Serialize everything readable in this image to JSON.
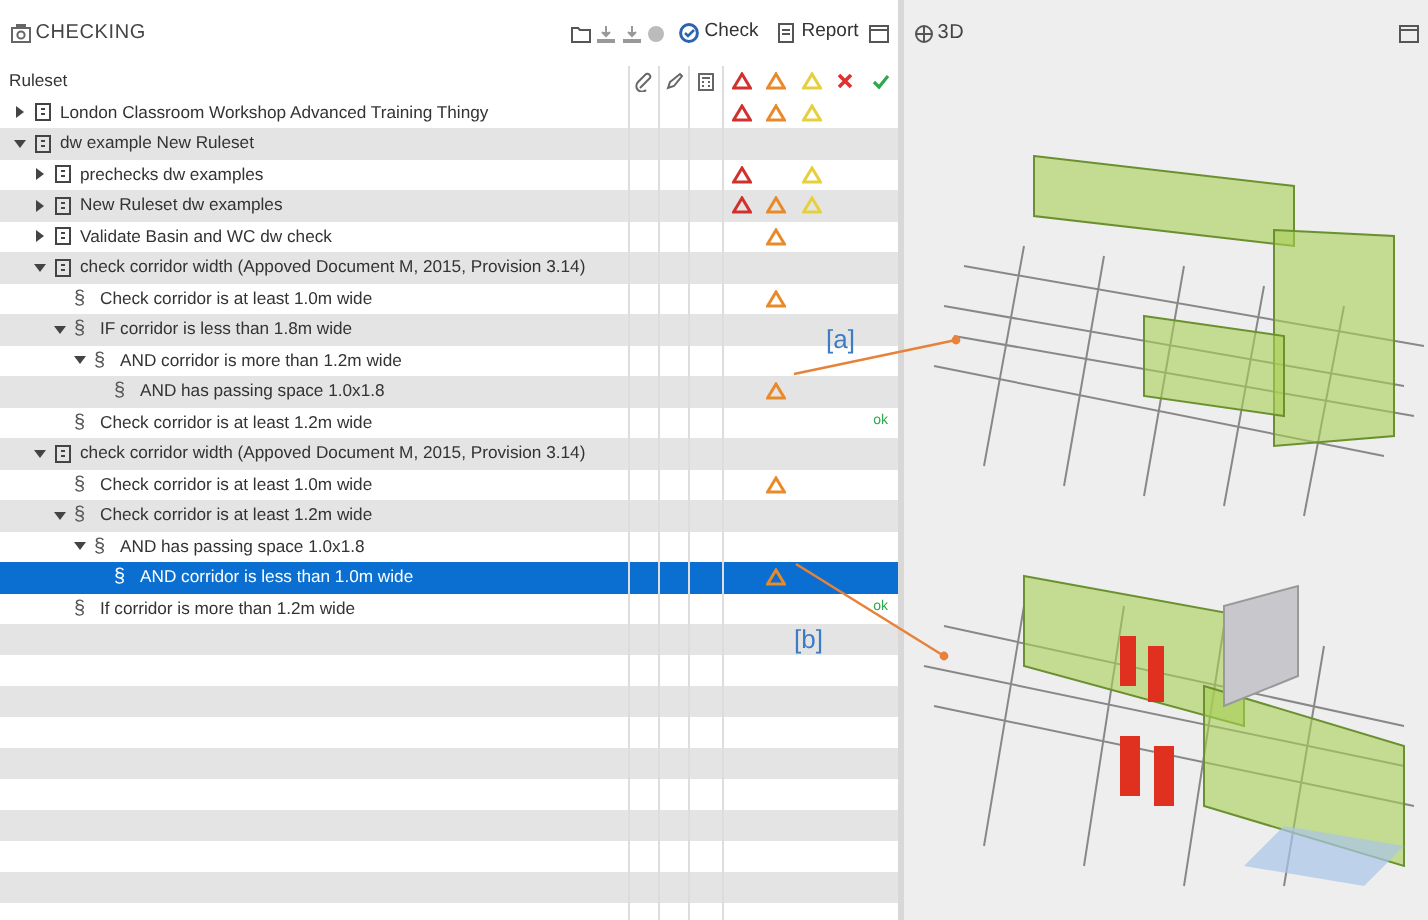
{
  "checking_panel": {
    "title": "CHECKING",
    "toolbar": [
      {
        "label": "Check"
      },
      {
        "label": "Report"
      }
    ],
    "header": {
      "column": "Ruleset"
    },
    "rows": [
      {
        "label": "London Classroom Workshop Advanced Training Thingy",
        "kind": "ruleset",
        "expanded": false,
        "selected": false,
        "critical": true,
        "major": true,
        "minor": true
      },
      {
        "label": "dw example New Ruleset",
        "kind": "ruleset",
        "expanded": true,
        "selected": false,
        "critical": false,
        "major": false,
        "minor": false,
        "children": [
          {
            "label": "prechecks dw examples",
            "kind": "ruleset",
            "expanded": false,
            "selected": false,
            "critical": true,
            "major": false,
            "minor": true
          },
          {
            "label": "New Ruleset dw examples",
            "kind": "ruleset",
            "expanded": false,
            "selected": false,
            "critical": true,
            "major": true,
            "minor": true
          },
          {
            "label": "Validate Basin and WC dw check",
            "kind": "ruleset",
            "expanded": false,
            "selected": false,
            "critical": false,
            "major": true,
            "minor": false
          },
          {
            "label": "check corridor width (Appoved Document M, 2015, Provision 3.14)",
            "kind": "ruleset",
            "expanded": true,
            "selected": false,
            "critical": false,
            "major": false,
            "minor": false,
            "children": [
              {
                "label": "Check corridor is at least 1.0m wide",
                "kind": "rule",
                "symbol": "§",
                "selected": false,
                "critical": false,
                "major": true,
                "minor": false
              },
              {
                "label": "IF corridor is less than 1.8m wide",
                "kind": "rule",
                "symbol": "§",
                "expanded": true,
                "selected": false,
                "critical": false,
                "major": false,
                "minor": false,
                "children": [
                  {
                    "label": "AND corridor is more than 1.2m wide",
                    "kind": "rule",
                    "symbol": "§",
                    "expanded": true,
                    "selected": false,
                    "critical": false,
                    "major": false,
                    "minor": false,
                    "children": [
                      {
                        "label": "AND has passing space 1.0x1.8",
                        "kind": "rule",
                        "symbol": "§",
                        "selected": false,
                        "critical": false,
                        "major": true,
                        "minor": false
                      }
                    ]
                  }
                ]
              },
              {
                "label": "Check corridor is at least 1.2m wide",
                "kind": "rule",
                "symbol": "§",
                "selected": false,
                "critical": false,
                "major": false,
                "minor": false,
                "ok": "ok"
              }
            ]
          },
          {
            "label": "check corridor width (Appoved Document M, 2015, Provision 3.14)",
            "kind": "ruleset",
            "expanded": true,
            "selected": false,
            "critical": false,
            "major": false,
            "minor": false,
            "children": [
              {
                "label": "Check corridor is at least 1.0m wide",
                "kind": "rule",
                "symbol": "§",
                "selected": false,
                "critical": false,
                "major": true,
                "minor": false
              },
              {
                "label": "Check corridor is at least 1.2m wide",
                "kind": "rule",
                "symbol": "§",
                "expanded": true,
                "selected": false,
                "critical": false,
                "major": false,
                "minor": false,
                "children": [
                  {
                    "label": "AND has passing space 1.0x1.8",
                    "kind": "rule",
                    "symbol": "§",
                    "expanded": true,
                    "selected": false,
                    "critical": false,
                    "major": false,
                    "minor": false,
                    "children": [
                      {
                        "label": "AND corridor is less than 1.0m wide",
                        "kind": "rule",
                        "symbol": "§",
                        "selected": true,
                        "critical": false,
                        "major": true,
                        "minor": false
                      }
                    ]
                  }
                ]
              },
              {
                "label": "If corridor is more than 1.2m wide",
                "kind": "rule",
                "symbol": "§",
                "selected": false,
                "critical": false,
                "major": false,
                "minor": false,
                "ok": "ok"
              }
            ]
          }
        ]
      }
    ]
  },
  "view_3d": {
    "title": "3D"
  },
  "annotations": [
    {
      "label": "[a]"
    },
    {
      "label": "[b]"
    }
  ]
}
